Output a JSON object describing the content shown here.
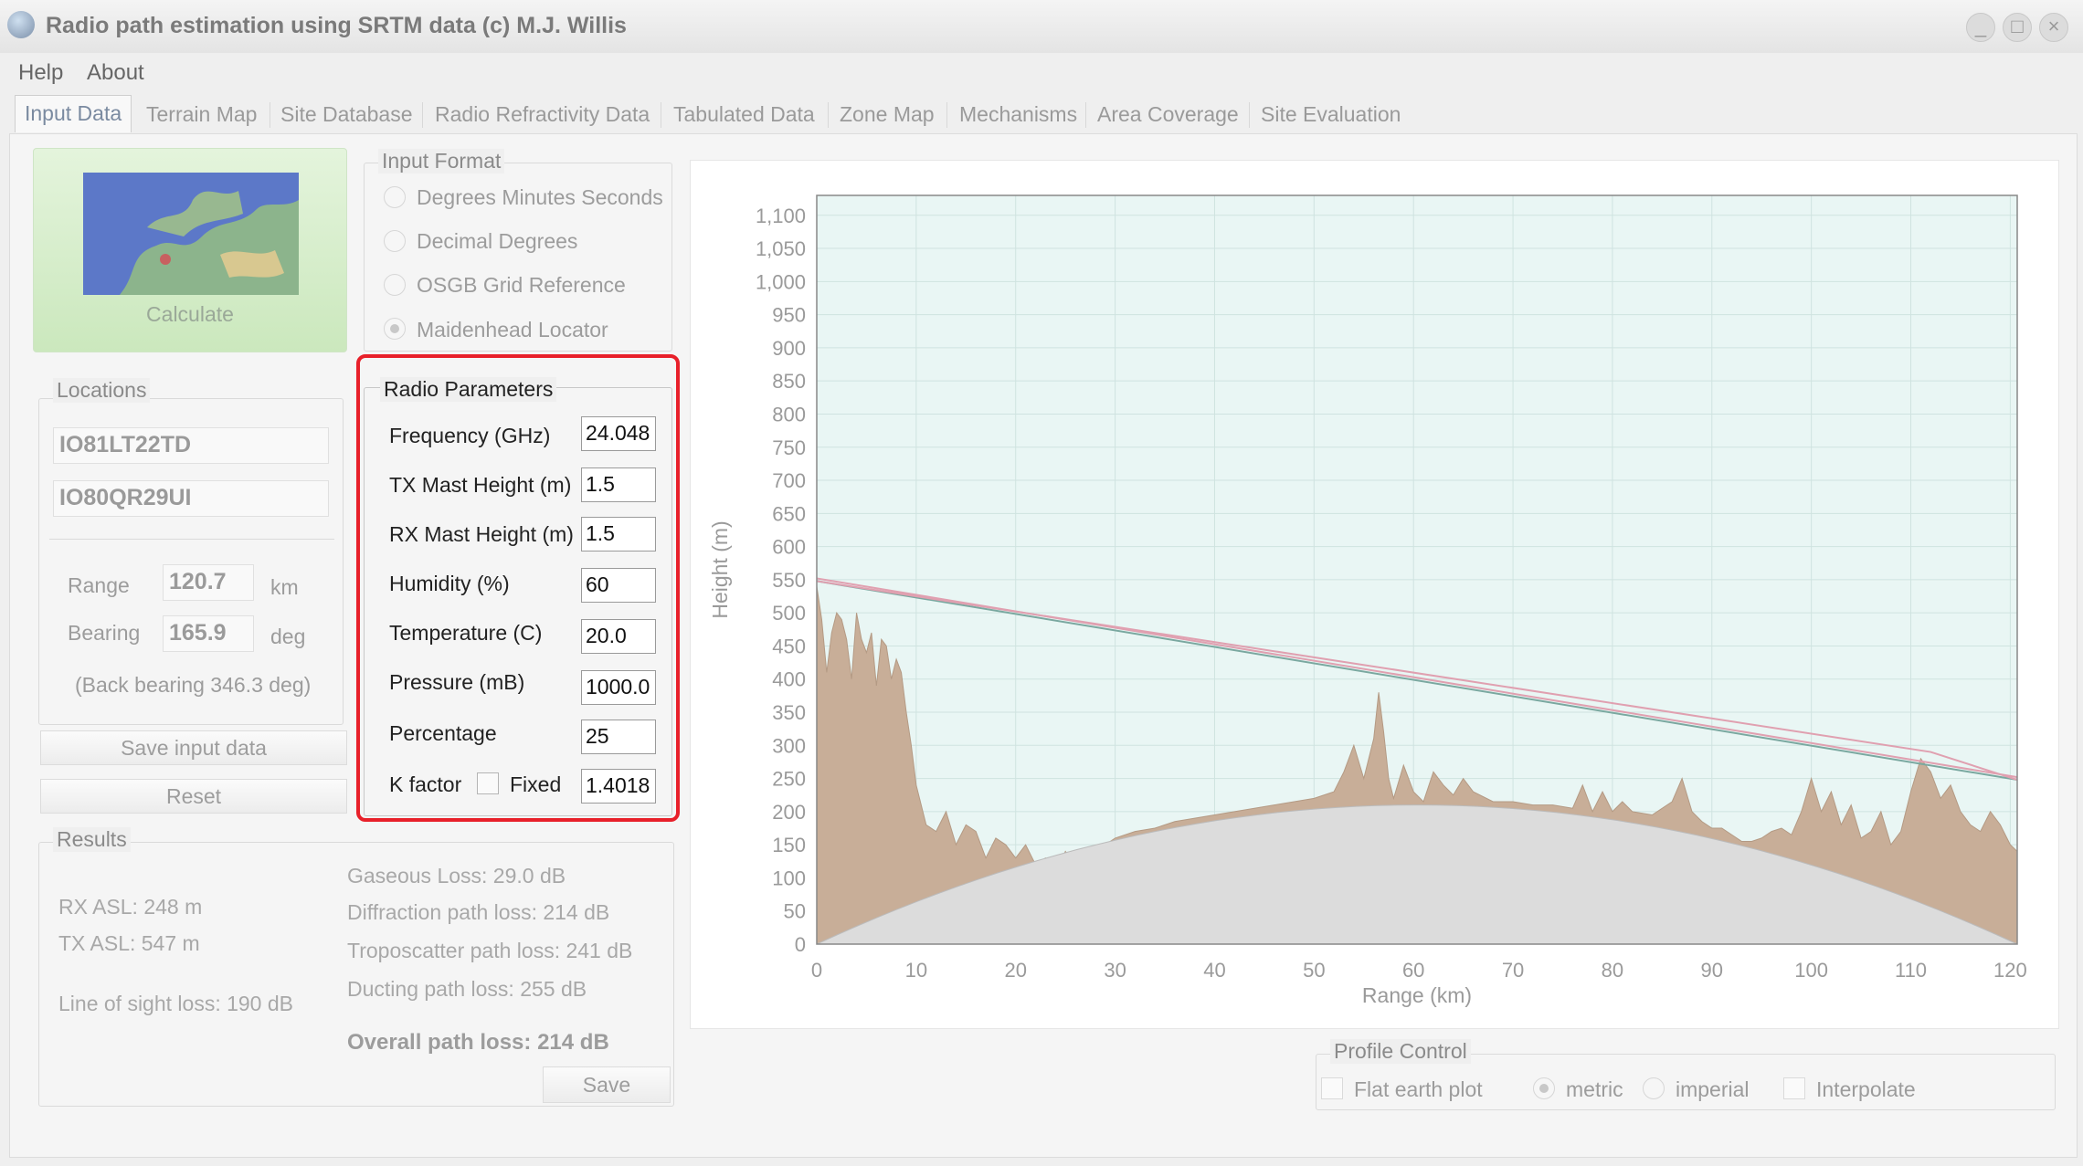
{
  "window": {
    "title": "Radio path estimation using SRTM data (c) M.J. Willis",
    "minimize": "_",
    "maximize": "□",
    "close": "×"
  },
  "menu": [
    "Help",
    "About"
  ],
  "tabs": [
    "Input Data",
    "Terrain Map",
    "Site Database",
    "Radio Refractivity Data",
    "Tabulated Data",
    "Zone Map",
    "Mechanisms",
    "Area Coverage",
    "Site Evaluation"
  ],
  "calculate": {
    "label": "Calculate"
  },
  "input_format": {
    "title": "Input Format",
    "options": [
      "Degrees Minutes Seconds",
      "Decimal Degrees",
      "OSGB Grid Reference",
      "Maidenhead Locator"
    ],
    "selected": "Maidenhead Locator"
  },
  "locations": {
    "title": "Locations",
    "loc1": "IO81LT22TD",
    "loc2": "IO80QR29UI",
    "range_label": "Range",
    "range_value": "120.7",
    "range_unit": "km",
    "bearing_label": "Bearing",
    "bearing_value": "165.9",
    "bearing_unit": "deg",
    "back_bearing": "(Back bearing 346.3 deg)"
  },
  "buttons": {
    "save_input": "Save input data",
    "reset": "Reset",
    "save": "Save"
  },
  "radio_params": {
    "title": "Radio Parameters",
    "frequency_label": "Frequency (GHz)",
    "frequency": "24.048",
    "tx_label": "TX Mast Height (m)",
    "tx": "1.5",
    "rx_label": "RX Mast Height (m)",
    "rx": "1.5",
    "humidity_label": "Humidity (%)",
    "humidity": "60",
    "temperature_label": "Temperature (C)",
    "temperature": "20.0",
    "pressure_label": "Pressure (mB)",
    "pressure": "1000.0",
    "percentage_label": "Percentage",
    "percentage": "25",
    "kfactor_label": "K factor",
    "fixed_label": "Fixed",
    "kfactor": "1.4018"
  },
  "results": {
    "title": "Results",
    "rx_asl": "RX ASL: 248 m",
    "tx_asl": "TX ASL: 547 m",
    "los_loss": "Line of sight loss: 190 dB",
    "gaseous": "Gaseous Loss: 29.0 dB",
    "diffraction": "Diffraction path loss: 214 dB",
    "troposcatter": "Troposcatter path loss: 241 dB",
    "ducting": "Ducting path loss: 255 dB",
    "overall": "Overall path loss: 214 dB"
  },
  "profile_control": {
    "title": "Profile Control",
    "flat_earth": "Flat earth plot",
    "metric": "metric",
    "imperial": "imperial",
    "interpolate": "Interpolate",
    "selected_units": "metric"
  },
  "colors": {
    "highlight": "#e8202a",
    "plot_bg": "#e9f6f4",
    "terrain": "#c8ae98",
    "earth": "#dcdcdc",
    "los_line": "#7aa8a0",
    "fresnel": "#e0a0b0"
  },
  "chart_data": {
    "type": "area",
    "xlabel": "Range (km)",
    "ylabel": "Height (m)",
    "xlim": [
      0,
      120.7
    ],
    "ylim": [
      0,
      1130
    ],
    "xticks": [
      0,
      10,
      20,
      30,
      40,
      50,
      60,
      70,
      80,
      90,
      100,
      110,
      120
    ],
    "yticks": [
      0,
      50,
      100,
      150,
      200,
      250,
      300,
      350,
      400,
      450,
      500,
      550,
      600,
      650,
      700,
      750,
      800,
      850,
      900,
      950,
      1000,
      1050,
      1100
    ],
    "ytick_labels": [
      "0",
      "50",
      "100",
      "150",
      "200",
      "250",
      "300",
      "350",
      "400",
      "450",
      "500",
      "550",
      "600",
      "650",
      "700",
      "750",
      "800",
      "850",
      "900",
      "950",
      "1,000",
      "1,050",
      "1,100"
    ],
    "grid": true,
    "earth_bulge_peak_m": 210,
    "terrain": {
      "x": [
        0,
        0.5,
        1,
        1.5,
        2,
        2.5,
        3,
        3.5,
        4,
        4.5,
        5,
        5.5,
        6,
        6.5,
        7,
        7.5,
        8,
        8.5,
        9,
        9.5,
        10,
        11,
        12,
        13,
        14,
        15,
        16,
        17,
        18,
        19,
        20,
        21,
        22,
        23,
        24,
        25,
        26,
        28,
        30,
        32,
        34,
        36,
        38,
        40,
        42,
        44,
        46,
        48,
        50,
        52,
        53,
        54,
        55,
        56,
        56.5,
        57,
        57.5,
        58,
        59,
        60,
        61,
        62,
        63,
        64,
        65,
        66,
        68,
        70,
        72,
        74,
        76,
        77,
        78,
        79,
        80,
        81,
        82,
        84,
        86,
        87,
        88,
        89,
        90,
        91,
        92,
        93,
        94,
        95,
        96,
        97,
        98,
        99,
        100,
        101,
        102,
        103,
        104,
        105,
        106,
        107,
        108,
        109,
        110,
        111,
        112,
        113,
        114,
        115,
        116,
        117,
        118,
        119,
        120,
        120.7
      ],
      "y": [
        540,
        490,
        410,
        470,
        500,
        490,
        460,
        400,
        500,
        460,
        440,
        470,
        390,
        460,
        450,
        400,
        430,
        410,
        350,
        300,
        240,
        180,
        170,
        200,
        150,
        180,
        170,
        130,
        160,
        150,
        130,
        150,
        120,
        130,
        110,
        140,
        120,
        140,
        160,
        170,
        175,
        185,
        190,
        195,
        200,
        205,
        210,
        215,
        220,
        230,
        260,
        300,
        250,
        310,
        380,
        320,
        250,
        220,
        270,
        230,
        215,
        260,
        240,
        225,
        250,
        230,
        215,
        215,
        210,
        210,
        205,
        240,
        200,
        230,
        200,
        215,
        200,
        195,
        215,
        250,
        200,
        185,
        175,
        175,
        165,
        155,
        155,
        160,
        170,
        175,
        165,
        200,
        250,
        200,
        230,
        180,
        210,
        160,
        170,
        200,
        150,
        170,
        230,
        280,
        260,
        220,
        240,
        200,
        180,
        170,
        200,
        180,
        150,
        140
      ]
    },
    "series": [
      {
        "name": "",
        "x": [
          0,
          120.7
        ],
        "y": [
          548,
          248
        ]
      },
      {
        "name": "",
        "x": [
          0,
          120.7
        ],
        "y": [
          552,
          252
        ]
      },
      {
        "name": "",
        "x": [
          0,
          112,
          120.7
        ],
        "y": [
          548,
          290,
          248
        ]
      }
    ]
  }
}
